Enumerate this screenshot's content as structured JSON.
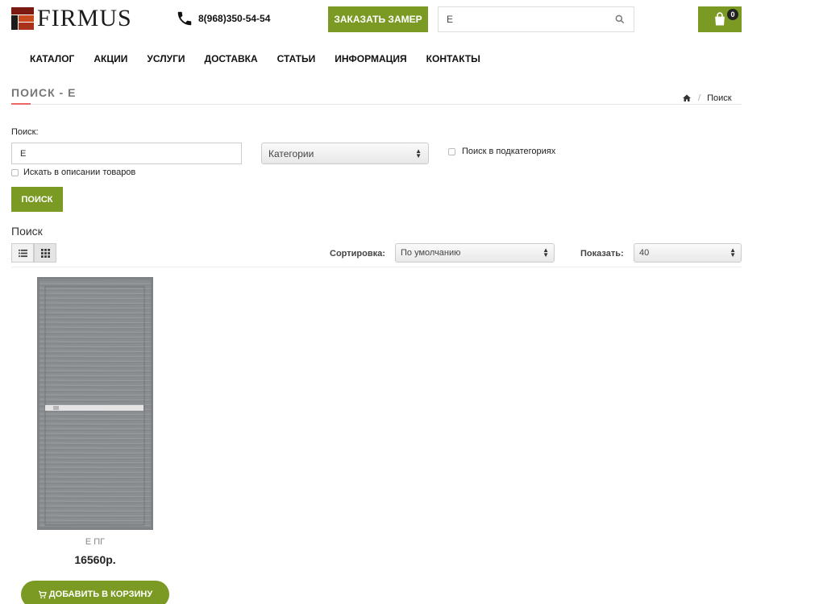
{
  "header": {
    "logo_text": "FIRMUS",
    "phone": "8(968)350-54-54",
    "order_button": "ЗАКАЗАТЬ ЗАМЕР",
    "search_value": "E",
    "cart_count": "0"
  },
  "nav": {
    "items": [
      "КАТАЛОГ",
      "АКЦИИ",
      "УСЛУГИ",
      "ДОСТАВКА",
      "СТАТЬИ",
      "ИНФОРМАЦИЯ",
      "КОНТАКТЫ"
    ]
  },
  "page": {
    "title": "ПОИСК - E",
    "breadcrumb_current": "Поиск"
  },
  "search_form": {
    "label": "Поиск:",
    "query_value": "E",
    "category_select": "Категории",
    "subcategories_label": "Поиск в подкатегориях",
    "description_label": "Искать в описании товаров",
    "submit_label": "ПОИСК"
  },
  "results": {
    "title": "Поиск",
    "sort_label": "Сортировка:",
    "sort_value": "По умолчанию",
    "show_label": "Показать:",
    "show_value": "40"
  },
  "product": {
    "name": "E ПГ",
    "price": "16560р.",
    "add_to_cart": "ДОБАВИТЬ В КОРЗИНУ"
  },
  "colors": {
    "accent_green": "#7a9a23",
    "title_accent": "#e66666"
  }
}
